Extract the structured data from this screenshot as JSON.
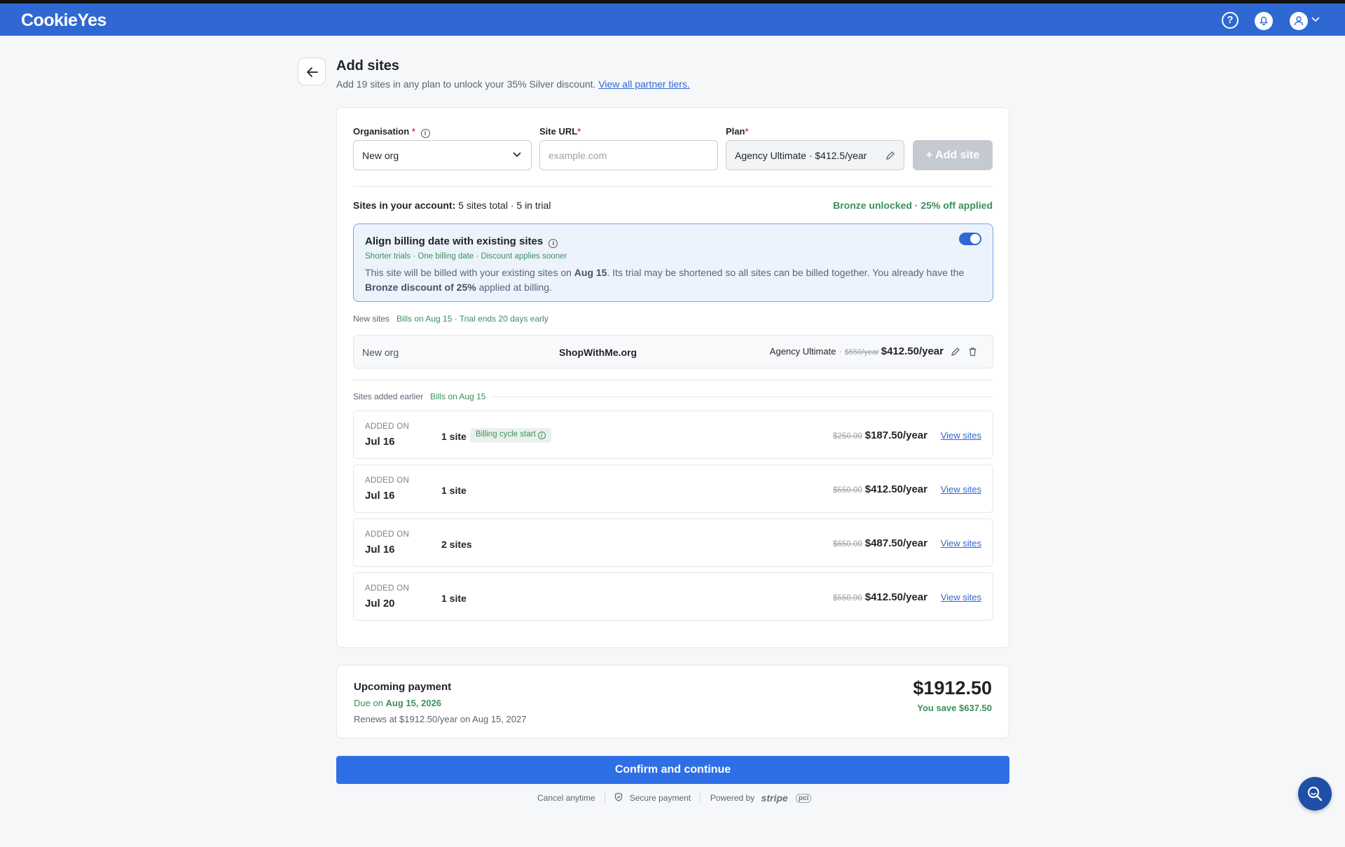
{
  "header": {
    "logo": "CookieYes",
    "icons": [
      "help-icon",
      "bell-icon",
      "user-icon",
      "chevron-down-icon"
    ]
  },
  "page": {
    "title": "Add sites",
    "subtitle": "Add 19 sites in any plan to unlock your 35% Silver discount.",
    "partner_link": "View all partner tiers."
  },
  "form": {
    "organisation_label": "Organisation",
    "organisation_value": "New org",
    "site_url_label": "Site URL",
    "site_url_placeholder": "example.com",
    "plan_label": "Plan",
    "plan_value": "Agency Ultimate · $412.5/year",
    "add_button": "+ Add site",
    "required_mark": "*"
  },
  "account": {
    "label": "Sites in your account:",
    "summary": "5 sites total · 5 in trial",
    "discount_status": "Bronze unlocked · 25% off applied"
  },
  "align": {
    "title": "Align billing date with existing sites",
    "tags": "Shorter trials · One billing date · Discount applies sooner",
    "desc_1": "This site will be billed with your existing sites on ",
    "desc_date": "Aug 15",
    "desc_2": ". Its trial may be shortened so all sites can be billed together. You already have the ",
    "desc_discount": "Bronze discount of 25%",
    "desc_3": " applied at billing.",
    "enabled": true
  },
  "new_sites": {
    "label": "New sites",
    "meta": "Bills on Aug 15 · Trial ends 20 days early",
    "row": {
      "org": "New org",
      "site": "ShopWithMe.org",
      "plan": "Agency Ultimate",
      "original_price": "$550/year",
      "price": "$412.50/year"
    }
  },
  "earlier_sites": {
    "label": "Sites added earlier",
    "meta": "Bills on Aug 15",
    "added_label": "ADDED ON",
    "view_label": "View sites",
    "rows": [
      {
        "date": "Jul 16",
        "count": "1 site",
        "badge": "Billing cycle start",
        "original": "$250.00",
        "price": "$187.50/year"
      },
      {
        "date": "Jul 16",
        "count": "1 site",
        "badge": "",
        "original": "$550.00",
        "price": "$412.50/year"
      },
      {
        "date": "Jul 16",
        "count": "2 sites",
        "badge": "",
        "original": "$650.00",
        "price": "$487.50/year"
      },
      {
        "date": "Jul 20",
        "count": "1 site",
        "badge": "",
        "original": "$550.00",
        "price": "$412.50/year"
      }
    ]
  },
  "payment": {
    "title": "Upcoming payment",
    "due_prefix": "Due on",
    "due_date": "Aug 15, 2026",
    "renews": "Renews at $1912.50/year on Aug 15, 2027",
    "total": "$1912.50",
    "savings": "You save $637.50"
  },
  "confirm_button": "Confirm and continue",
  "footer": {
    "cancel": "Cancel anytime",
    "secure": "Secure payment",
    "powered": "Powered by",
    "stripe": "stripe",
    "pci": "pci"
  },
  "colors": {
    "brand": "#2f68d3",
    "button": "#2f6fe6",
    "success": "#3b8f5c",
    "align_bg": "#edf3fd"
  }
}
